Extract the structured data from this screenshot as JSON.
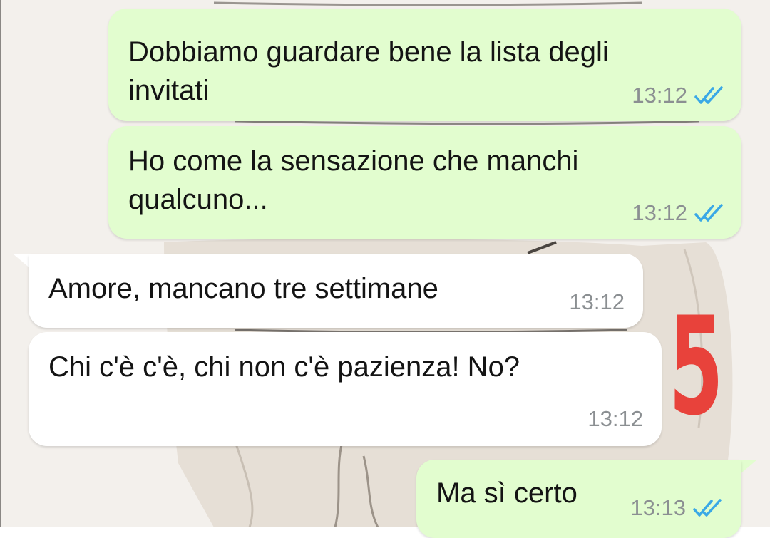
{
  "messages": [
    {
      "direction": "outgoing",
      "text": "Dobbiamo guardare bene la lista degli\ninvitati",
      "time": "13:12",
      "status": "read",
      "icon": "double-check-icon"
    },
    {
      "direction": "outgoing",
      "text": "Ho come la sensazione che manchi\nqualcuno...",
      "time": "13:12",
      "status": "read",
      "icon": "double-check-icon"
    },
    {
      "direction": "incoming",
      "text": "Amore, mancano tre settimane",
      "time": "13:12"
    },
    {
      "direction": "incoming",
      "text": "Chi c'è c'è, chi non c'è pazienza! No?",
      "time": "13:12"
    },
    {
      "direction": "outgoing",
      "text": "Ma sì certo",
      "time": "13:13",
      "status": "read",
      "icon": "double-check-icon"
    }
  ],
  "annotation": "5",
  "colors": {
    "outgoing_bubble": "#e2fdcf",
    "incoming_bubble": "#ffffff",
    "read_tick": "#3aa8e6",
    "annotation": "#e8423b",
    "timestamp": "#8b8f92"
  }
}
